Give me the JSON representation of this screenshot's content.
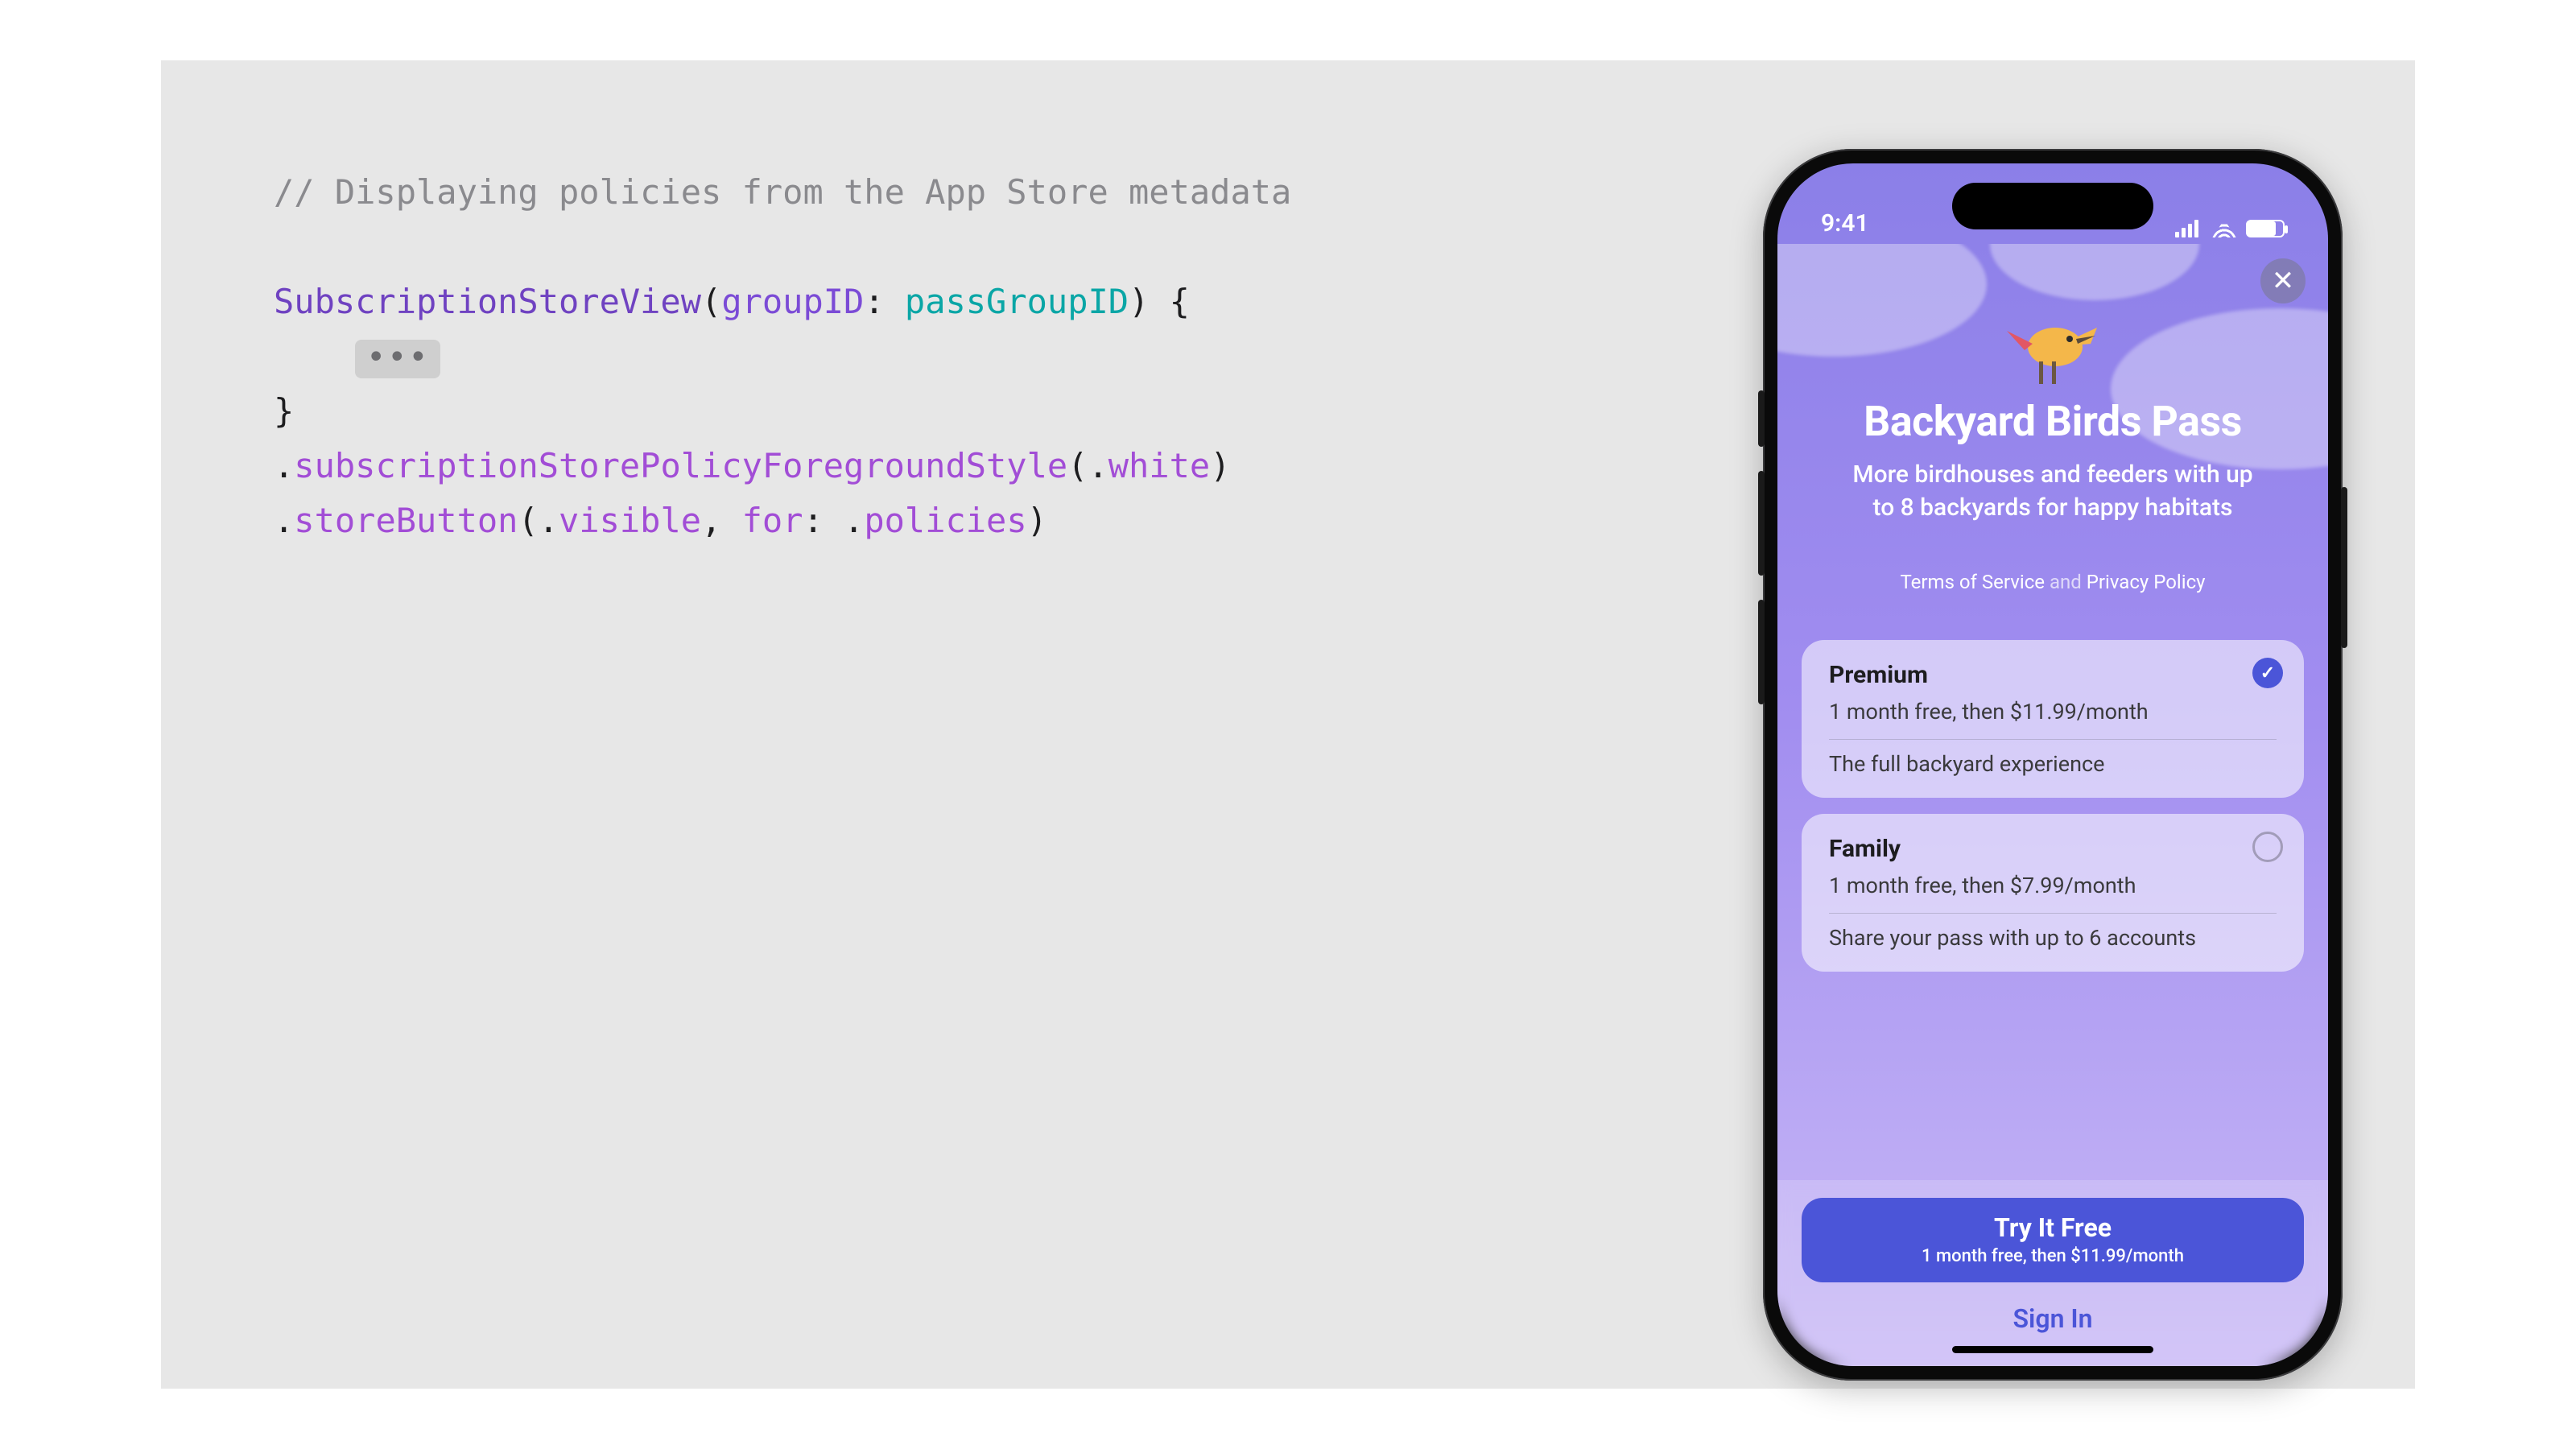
{
  "code": {
    "comment": "// Displaying policies from the App Store metadata",
    "type": "SubscriptionStoreView",
    "param_label": "groupID",
    "param_value": "passGroupID",
    "ellipsis": "•••",
    "method1": "subscriptionStorePolicyForegroundStyle",
    "method1_arg": "white",
    "method2": "storeButton",
    "method2_arg1": "visible",
    "method2_for": "for",
    "method2_arg2": "policies"
  },
  "phone": {
    "time": "9:41",
    "close": "✕",
    "hero": {
      "title": "Backyard Birds Pass",
      "subtitle": "More birdhouses and feeders with up to 8 backyards for happy habitats"
    },
    "policies": {
      "tos": "Terms of Service",
      "sep": "and",
      "privacy": "Privacy Policy"
    },
    "plans": [
      {
        "name": "Premium",
        "price": "1 month free, then $11.99/month",
        "desc": "The full backyard experience",
        "selected": true
      },
      {
        "name": "Family",
        "price": "1 month free, then $7.99/month",
        "desc": "Share your pass with up to 6 accounts",
        "selected": false
      }
    ],
    "cta": {
      "title": "Try It Free",
      "sub": "1 month free, then $11.99/month"
    },
    "signin": "Sign In"
  }
}
